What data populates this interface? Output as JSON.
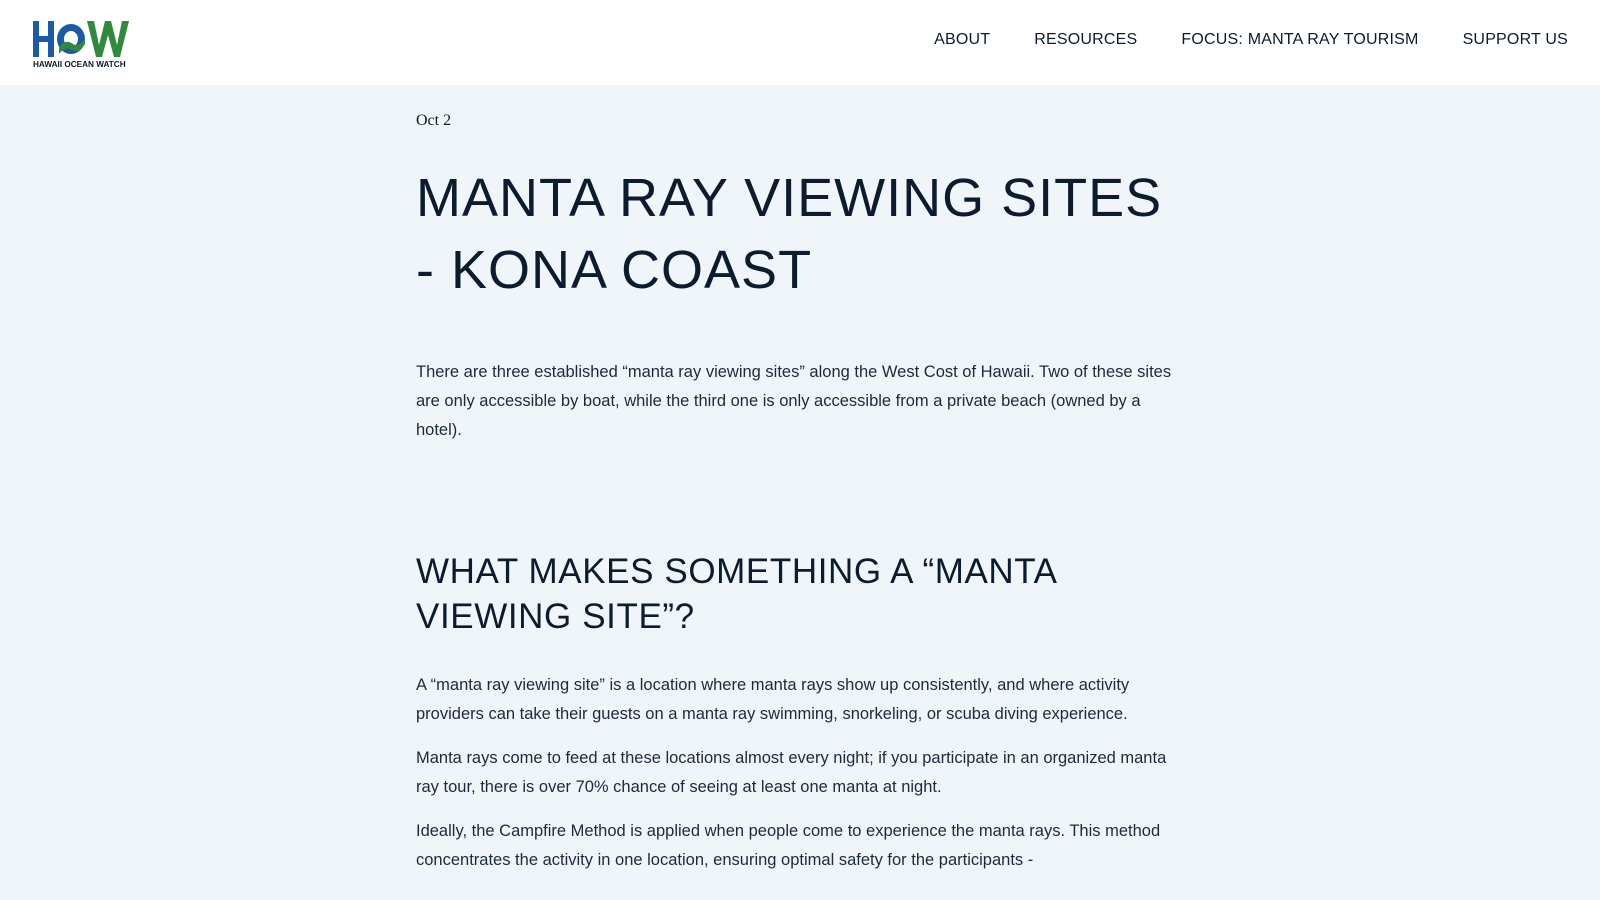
{
  "site": {
    "logo_text": "HOW",
    "logo_subtext": "HAWAII OCEAN WATCH",
    "brand_colors": {
      "blue": "#1b5aa6",
      "green": "#2f8a3d",
      "ink": "#0d1b2e"
    }
  },
  "nav": {
    "items": [
      {
        "label": "ABOUT"
      },
      {
        "label": "RESOURCES"
      },
      {
        "label": "FOCUS: MANTA RAY TOURISM"
      },
      {
        "label": "SUPPORT US"
      }
    ]
  },
  "article": {
    "date": "Oct 2",
    "title": "MANTA RAY VIEWING SITES - KONA COAST",
    "intro": "There are three established “manta ray viewing sites” along the West Cost of Hawaii. Two of these sites are only accessible by boat, while the third one is only accessible from a private beach (owned by a hotel).",
    "section_heading": "WHAT MAKES SOMETHING A “MANTA VIEWING SITE”?",
    "paragraphs": [
      "A “manta ray viewing site” is a location where manta rays show up consistently, and where activity providers can take their guests on a manta ray swimming, snorkeling, or scuba diving experience.",
      "Manta rays come to feed at these locations almost every night; if you participate in an organized manta ray tour, there is over 70% chance of seeing at least one manta at night.",
      "Ideally, the Campfire Method is applied when people come to experience the manta rays. This method concentrates the activity in one location, ensuring optimal safety for the participants -"
    ]
  }
}
